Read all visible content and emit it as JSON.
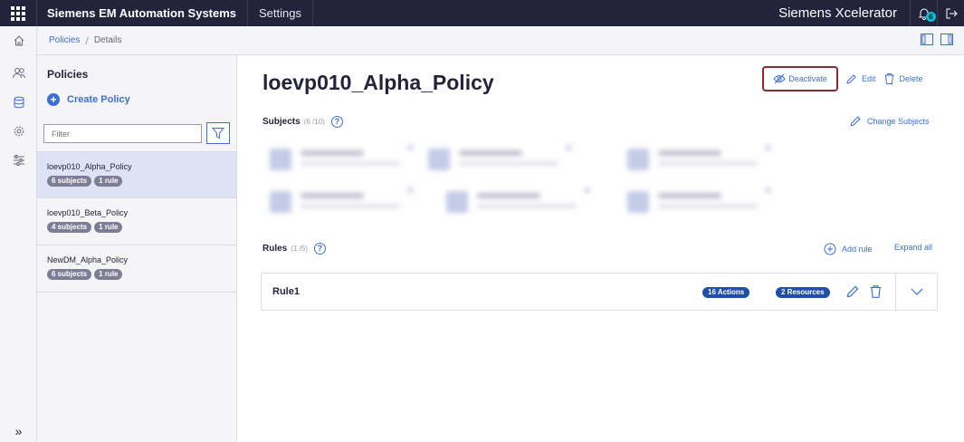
{
  "topbar": {
    "brand": "Siemens EM Automation Systems",
    "settings": "Settings",
    "product": "Siemens Xcelerator",
    "notification_count": "6"
  },
  "rail": {
    "items": [
      "home-icon",
      "users-icon",
      "database-icon",
      "gear-icon",
      "sliders-icon"
    ],
    "expand_label": "»"
  },
  "breadcrumb": {
    "items": [
      "Policies",
      "Details"
    ]
  },
  "policies_panel": {
    "title": "Policies",
    "create_label": "Create Policy",
    "filter_placeholder": "Filter",
    "items": [
      {
        "name": "loevp010_Alpha_Policy",
        "subjects": "6 subjects",
        "rules": "1 rule",
        "selected": true
      },
      {
        "name": "loevp010_Beta_Policy",
        "subjects": "4 subjects",
        "rules": "1 rule",
        "selected": false
      },
      {
        "name": "NewDM_Alpha_Policy",
        "subjects": "6 subjects",
        "rules": "1 rule",
        "selected": false
      }
    ]
  },
  "main": {
    "title": "loevp010_Alpha_Policy",
    "actions": {
      "deactivate": "Deactivate",
      "edit": "Edit",
      "delete": "Delete"
    },
    "subjects": {
      "label": "Subjects",
      "count": "(6 /10)",
      "change_label": "Change Subjects"
    },
    "rules": {
      "label": "Rules",
      "count": "(1 /5)",
      "add_label": "Add rule",
      "expand_label": "Expand all",
      "items": [
        {
          "name": "Rule1",
          "actions": "16 Actions",
          "resources": "2 Resources"
        }
      ]
    }
  },
  "colors": {
    "topbar": "#23233c",
    "accent": "#3c6fd4",
    "highlight_border": "#8a2a2a",
    "selected_row": "#dde3f3",
    "badge_dark": "#1f4fa8",
    "badge_gray": "#7d7d96"
  }
}
